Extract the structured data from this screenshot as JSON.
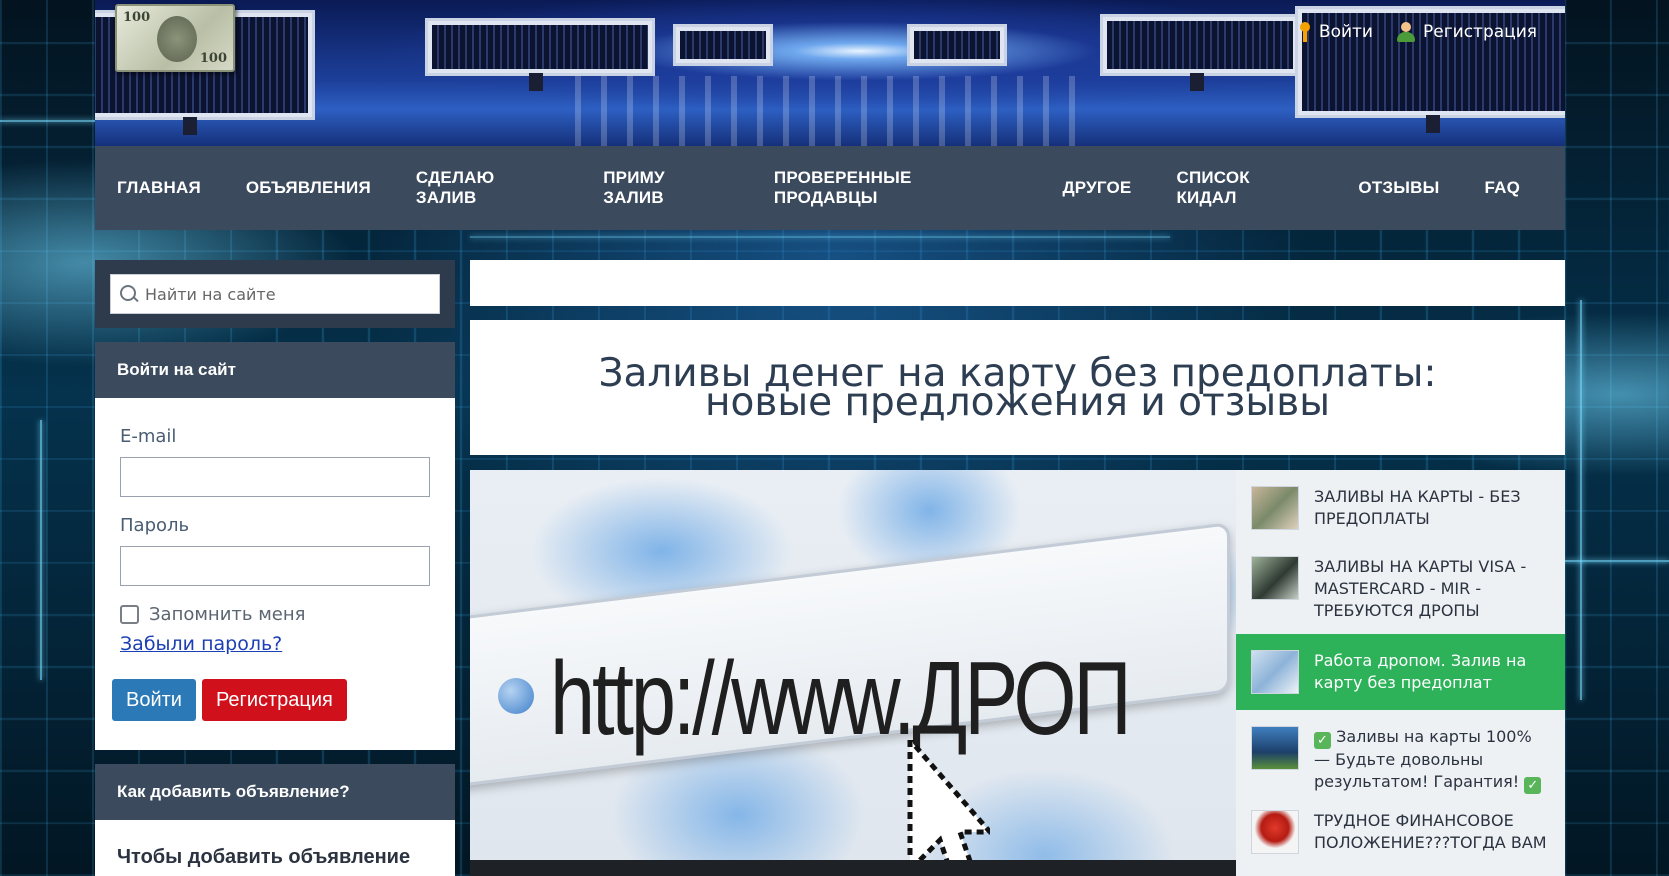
{
  "header": {
    "login_label": "Войти",
    "register_label": "Регистрация"
  },
  "nav": {
    "items": [
      {
        "label": "ГЛАВНАЯ"
      },
      {
        "label": "ОБЪЯВЛЕНИЯ"
      },
      {
        "label": "СДЕЛАЮ ЗАЛИВ"
      },
      {
        "label": "ПРИМУ ЗАЛИВ"
      },
      {
        "label": "ПРОВЕРЕННЫЕ ПРОДАВЦЫ"
      },
      {
        "label": "ДРУГОЕ"
      },
      {
        "label": "СПИСОК КИДАЛ"
      },
      {
        "label": "ОТЗЫВЫ"
      },
      {
        "label": "FAQ"
      }
    ]
  },
  "search": {
    "placeholder": "Найти на сайте"
  },
  "login_widget": {
    "title": "Войти на сайт",
    "email_label": "E-mail",
    "password_label": "Пароль",
    "remember_label": "Запомнить меня",
    "forgot_label": "Забыли пароль?",
    "login_button": "Войти",
    "register_button": "Регистрация"
  },
  "howto_widget": {
    "title": "Как добавить объявление?",
    "body_start": "Чтобы добавить объявление —"
  },
  "main": {
    "title": "Заливы денег на карту без предоплаты: новые предложения и отзывы",
    "hero_url_text": "http://www.ДРОП"
  },
  "related": {
    "items": [
      {
        "text": "ЗАЛИВЫ НА КАРТЫ - БЕЗ ПРЕДОПЛАТЫ",
        "active": false
      },
      {
        "text": "ЗАЛИВЫ НА КАРТЫ VISA - MASTERCARD - MIR - ТРЕБУЮТСЯ ДРОПЫ",
        "active": false
      },
      {
        "text": "Работа дропом. Залив на карту без предоплат",
        "active": true
      },
      {
        "text": "Заливы на карты 100% — Будьте довольны результатом! Гарантия!",
        "active": false
      },
      {
        "text": "ТРУДНОЕ ФИНАНСОВОЕ ПОЛОЖЕНИЕ???ТОГДА ВАМ",
        "active": false
      }
    ]
  },
  "colors": {
    "nav_bg": "#3b4a5d",
    "active_related_bg": "#2db25a",
    "login_button_bg": "#2c79b8",
    "register_button_bg": "#d0101b"
  }
}
